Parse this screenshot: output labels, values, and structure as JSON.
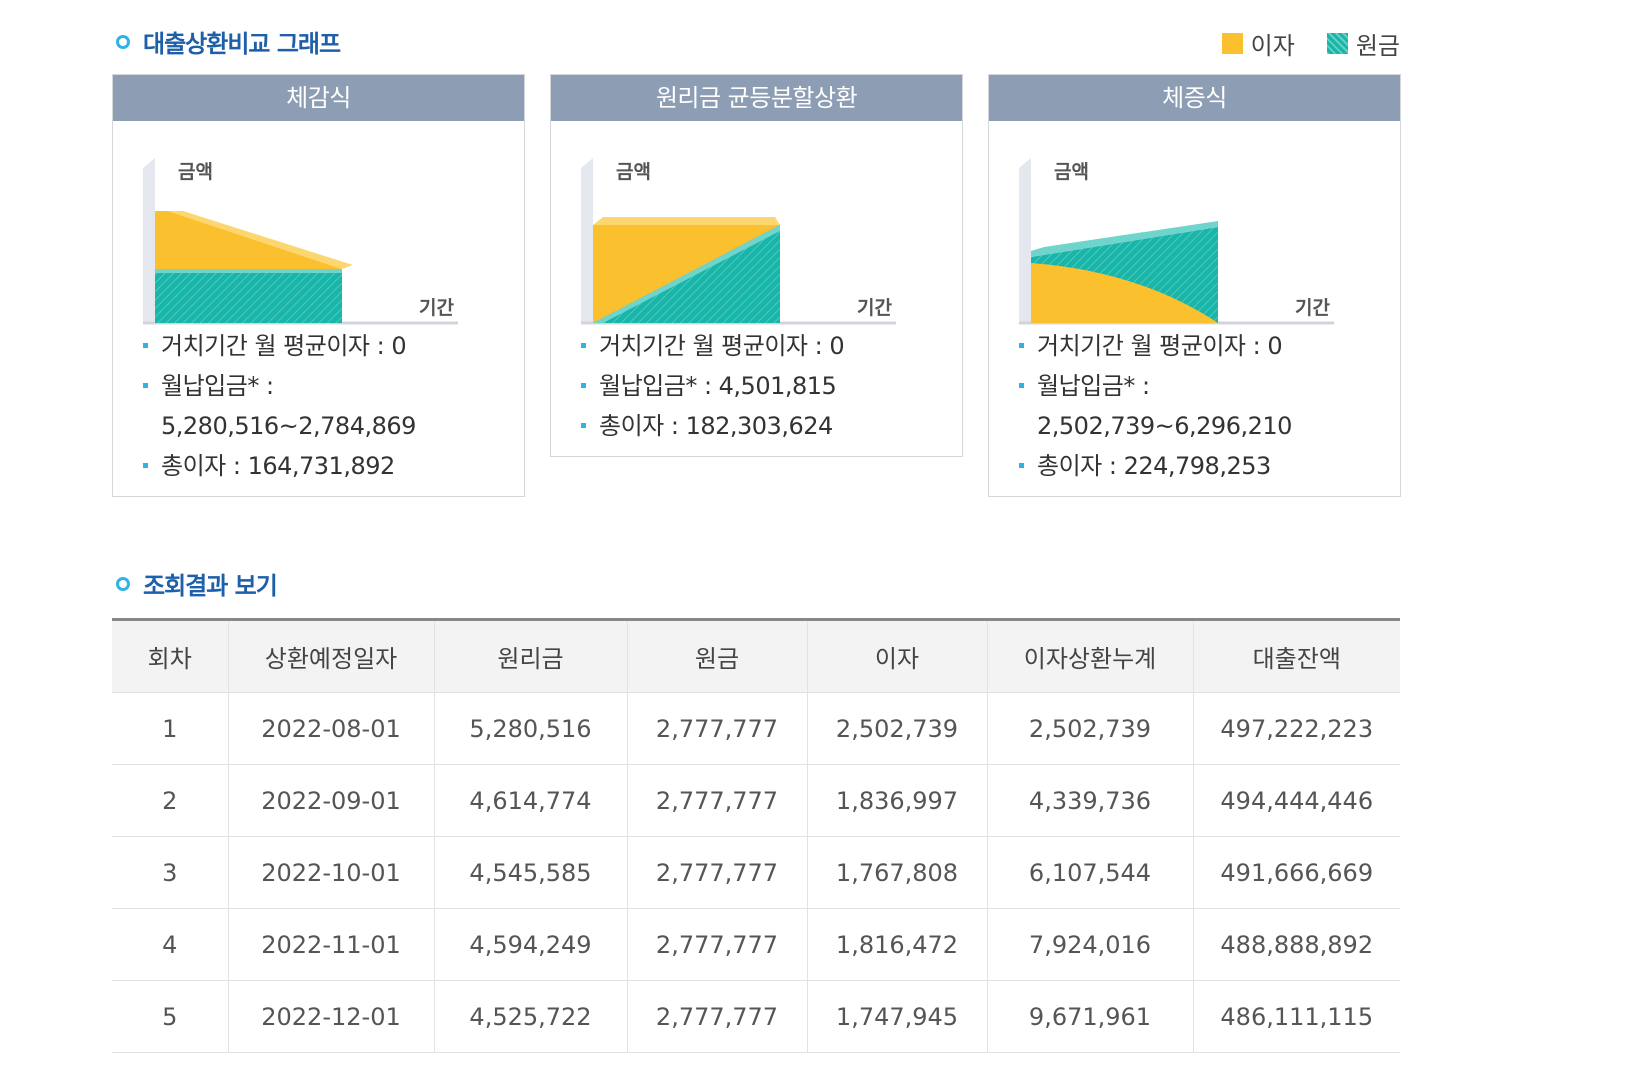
{
  "graph_section": {
    "title": "대출상환비교 그래프"
  },
  "legend": {
    "interest": "이자",
    "principal": "원금"
  },
  "colors": {
    "interest": "#fbc02d",
    "principal": "#18b5a8",
    "card_header": "#8d9db4",
    "accent": "#2fb2e8",
    "title": "#1d5fa8"
  },
  "axis": {
    "y": "금액",
    "x": "기간"
  },
  "cards": [
    {
      "title": "체감식",
      "shape": "decreasing",
      "info": [
        "거치기간 월 평균이자 : 0",
        "월납입금* :",
        "5,280,516~2,784,869",
        "총이자 : 164,731,892"
      ]
    },
    {
      "title": "원리금 균등분할상환",
      "shape": "equal",
      "info": [
        "거치기간 월 평균이자 : 0",
        "월납입금* : 4,501,815",
        "총이자 : 182,303,624"
      ]
    },
    {
      "title": "체증식",
      "shape": "increasing",
      "info": [
        "거치기간 월 평균이자 : 0",
        "월납입금* :",
        "2,502,739~6,296,210",
        "총이자 : 224,798,253"
      ]
    }
  ],
  "results_section": {
    "title": "조회결과 보기"
  },
  "table": {
    "headers": [
      "회차",
      "상환예정일자",
      "원리금",
      "원금",
      "이자",
      "이자상환누계",
      "대출잔액"
    ],
    "rows": [
      [
        "1",
        "2022-08-01",
        "5,280,516",
        "2,777,777",
        "2,502,739",
        "2,502,739",
        "497,222,223"
      ],
      [
        "2",
        "2022-09-01",
        "4,614,774",
        "2,777,777",
        "1,836,997",
        "4,339,736",
        "494,444,446"
      ],
      [
        "3",
        "2022-10-01",
        "4,545,585",
        "2,777,777",
        "1,767,808",
        "6,107,544",
        "491,666,669"
      ],
      [
        "4",
        "2022-11-01",
        "4,594,249",
        "2,777,777",
        "1,816,472",
        "7,924,016",
        "488,888,892"
      ],
      [
        "5",
        "2022-12-01",
        "4,525,722",
        "2,777,777",
        "1,747,945",
        "9,671,961",
        "486,111,115"
      ]
    ]
  }
}
